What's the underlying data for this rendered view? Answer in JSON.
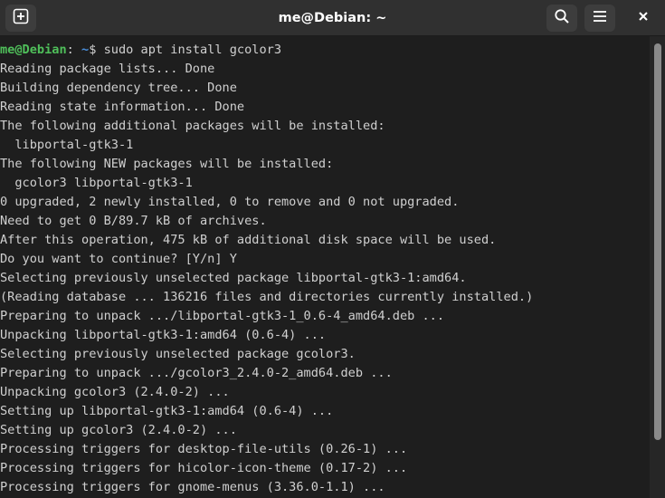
{
  "window": {
    "title": "me@Debian: ~"
  },
  "headerbar": {
    "new_tab_icon": "new-tab-icon",
    "search_icon": "search-icon",
    "menu_icon": "hamburger-menu-icon",
    "close_icon": "close-icon"
  },
  "terminal": {
    "prompt_user": "me@Debian",
    "prompt_colon": ":",
    "prompt_path": " ~",
    "prompt_dollar": "$",
    "command": " sudo apt install gcolor3",
    "output": [
      "Reading package lists... Done",
      "Building dependency tree... Done",
      "Reading state information... Done",
      "The following additional packages will be installed:",
      "  libportal-gtk3-1",
      "The following NEW packages will be installed:",
      "  gcolor3 libportal-gtk3-1",
      "0 upgraded, 2 newly installed, 0 to remove and 0 not upgraded.",
      "Need to get 0 B/89.7 kB of archives.",
      "After this operation, 475 kB of additional disk space will be used.",
      "Do you want to continue? [Y/n] Y",
      "Selecting previously unselected package libportal-gtk3-1:amd64.",
      "(Reading database ... 136216 files and directories currently installed.)",
      "Preparing to unpack .../libportal-gtk3-1_0.6-4_amd64.deb ...",
      "Unpacking libportal-gtk3-1:amd64 (0.6-4) ...",
      "Selecting previously unselected package gcolor3.",
      "Preparing to unpack .../gcolor3_2.4.0-2_amd64.deb ...",
      "Unpacking gcolor3 (2.4.0-2) ...",
      "Setting up libportal-gtk3-1:amd64 (0.6-4) ...",
      "Setting up gcolor3 (2.4.0-2) ...",
      "Processing triggers for desktop-file-utils (0.26-1) ...",
      "Processing triggers for hicolor-icon-theme (0.17-2) ...",
      "Processing triggers for gnome-menus (3.36.0-1.1) ..."
    ]
  },
  "colors": {
    "background": "#1e1e1e",
    "headerbar": "#303030",
    "text": "#d0d0d0",
    "prompt_user": "#4fbf5a",
    "prompt_path": "#4a8fdc"
  }
}
